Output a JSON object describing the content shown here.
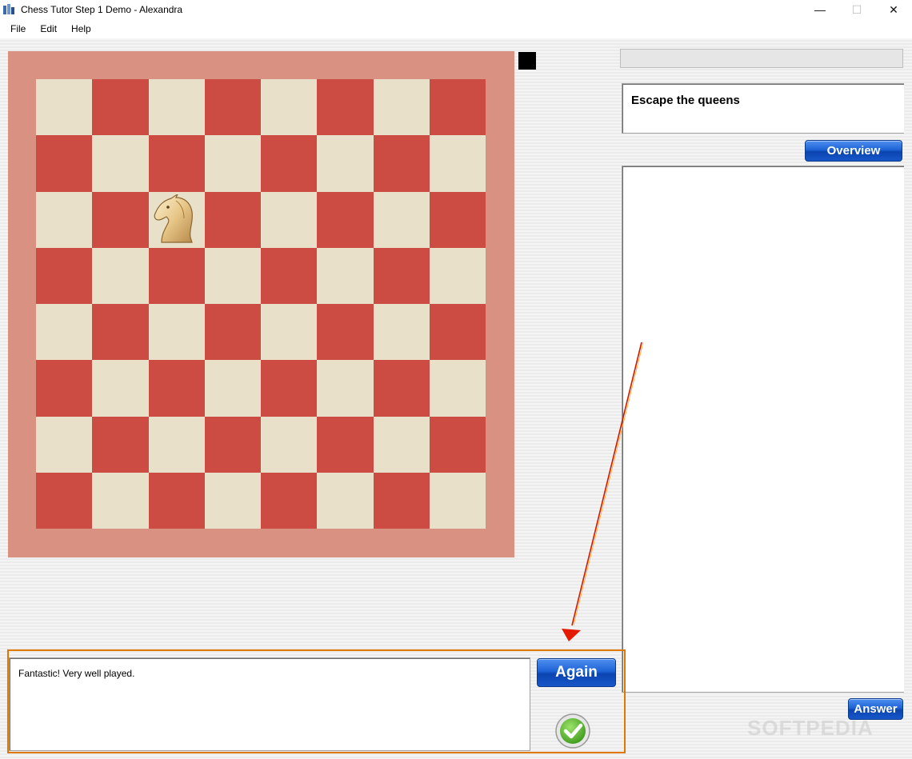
{
  "window": {
    "title": "Chess Tutor Step 1 Demo - Alexandra",
    "controls": {
      "minimize": "—",
      "maximize": "☐",
      "close": "✕"
    }
  },
  "menu": {
    "items": [
      "File",
      "Edit",
      "Help"
    ]
  },
  "board": {
    "light_color": "#e8e0c8",
    "dark_color": "#cc4b42",
    "frame_color": "#d99282",
    "pieces": [
      {
        "type": "knight",
        "color": "white",
        "square": "c6"
      }
    ],
    "turn_indicator": "black"
  },
  "panel": {
    "task_title": "Escape the queens",
    "overview_label": "Overview",
    "answer_label": "Answer",
    "notes": ""
  },
  "feedback": {
    "message": "Fantastic! Very well played.",
    "again_label": "Again",
    "status_icon": "check-icon"
  },
  "annotation": {
    "color": "#e07800",
    "arrow_color": "#d01a00"
  },
  "watermark": "SOFTPEDIA"
}
